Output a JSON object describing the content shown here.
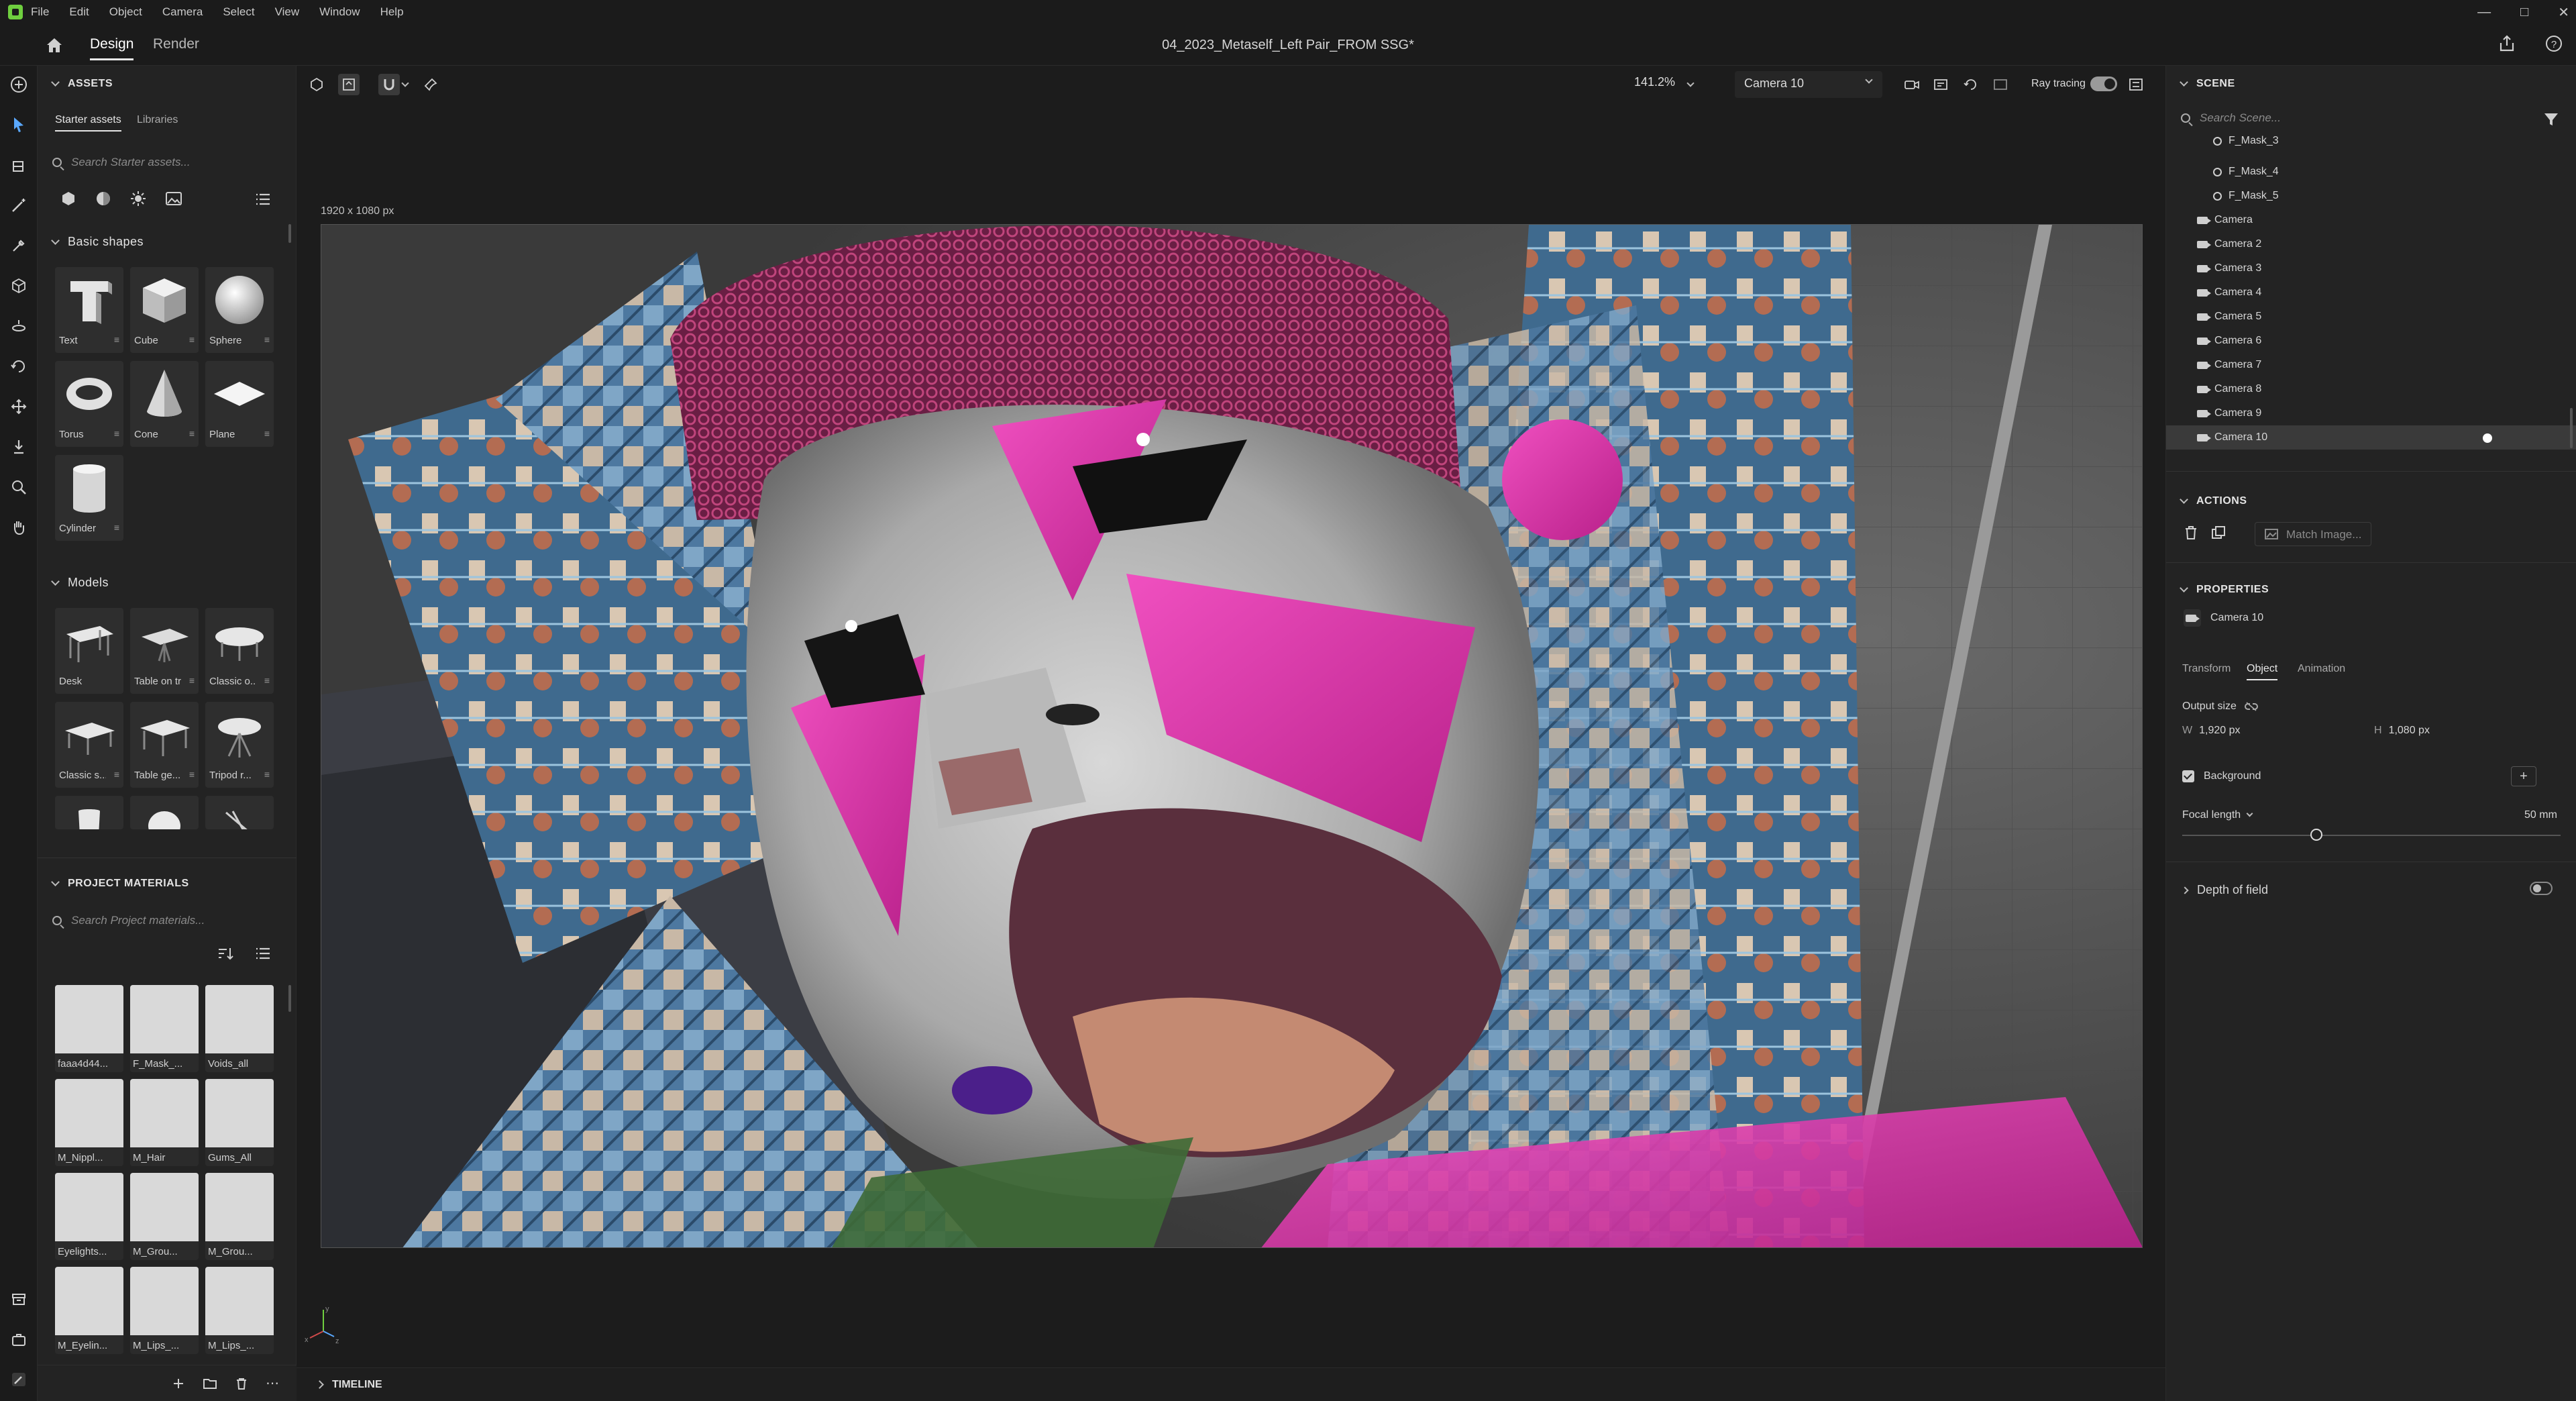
{
  "menubar": {
    "items": [
      "File",
      "Edit",
      "Object",
      "Camera",
      "Select",
      "View",
      "Window",
      "Help"
    ]
  },
  "titlebar": {
    "tabs": [
      "Design",
      "Render"
    ],
    "active_tab": "Design",
    "document_title": "04_2023_Metaself_Left Pair_FROM SSG*"
  },
  "assets": {
    "header": "ASSETS",
    "subtabs": [
      "Starter assets",
      "Libraries"
    ],
    "search_placeholder": "Search Starter assets...",
    "basic_shapes": {
      "header": "Basic shapes",
      "items": [
        "Text",
        "Cube",
        "Sphere",
        "Torus",
        "Cone",
        "Plane",
        "Cylinder"
      ]
    },
    "models": {
      "header": "Models",
      "items": [
        "Desk",
        "Table on tr...",
        "Classic o...",
        "Classic s...",
        "Table ge...",
        "Tripod r..."
      ]
    }
  },
  "project_materials": {
    "header": "PROJECT MATERIALS",
    "search_placeholder": "Search Project materials...",
    "items": [
      "faaa4d44...",
      "F_Mask_...",
      "Voids_all",
      "M_Nippl...",
      "M_Hair",
      "Gums_All",
      "Eyelights...",
      "M_Grou...",
      "M_Grou...",
      "M_Eyelin...",
      "M_Lips_...",
      "M_Lips_..."
    ]
  },
  "viewport": {
    "zoom": "141.2%",
    "camera": "Camera 10",
    "ray_tracing_label": "Ray tracing",
    "ray_tracing_on": true,
    "output_size_label": "1920 x 1080 px"
  },
  "timeline": {
    "label": "TIMELINE"
  },
  "scene": {
    "header": "SCENE",
    "search_placeholder": "Search Scene...",
    "items": [
      "F_Mask_3",
      "F_Mask_4",
      "F_Mask_5",
      "Camera",
      "Camera 2",
      "Camera 3",
      "Camera 4",
      "Camera 5",
      "Camera 6",
      "Camera 7",
      "Camera 8",
      "Camera 9",
      "Camera 10"
    ],
    "selected": "Camera 10"
  },
  "actions": {
    "header": "ACTIONS",
    "match_image": "Match Image..."
  },
  "properties": {
    "header": "PROPERTIES",
    "object_name": "Camera 10",
    "tabs": [
      "Transform",
      "Object",
      "Animation"
    ],
    "active_tab": "Object",
    "output_size_label": "Output size",
    "width_label": "W",
    "width_value": "1,920 px",
    "height_label": "H",
    "height_value": "1,080 px",
    "background_label": "Background",
    "background_checked": true,
    "focal_length_label": "Focal length",
    "focal_length_value": "50 mm",
    "depth_of_field_label": "Depth of field"
  },
  "colors": {
    "accent": "#5aa9ff",
    "logo": "#6fcf3f",
    "panel_bg": "#232323",
    "app_bg": "#1b1b1b"
  }
}
